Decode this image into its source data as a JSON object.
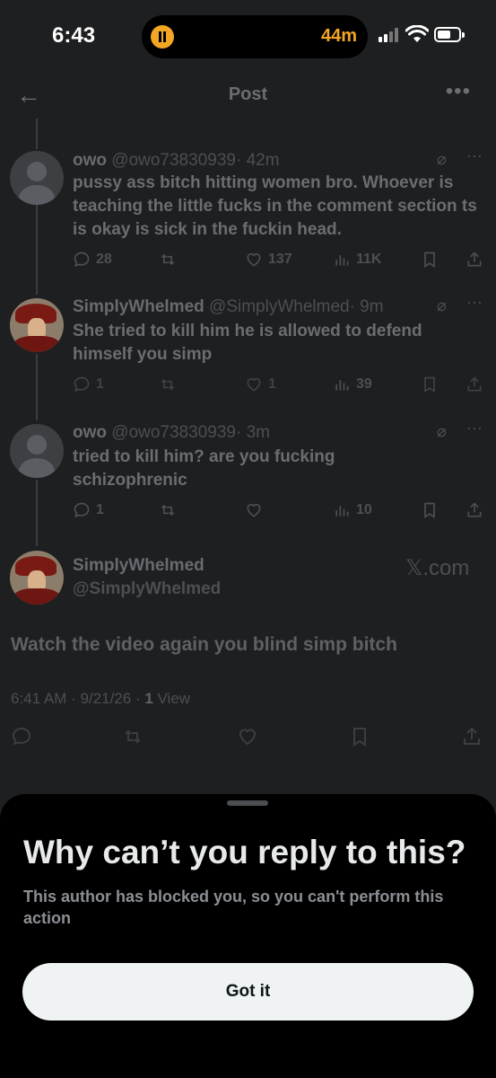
{
  "status_bar": {
    "time": "6:43",
    "activity_minutes": "44m"
  },
  "header": {
    "back_icon": "←",
    "title": "Post",
    "more_icon": "•••"
  },
  "replies": [
    {
      "name": "owo",
      "handle": "@owo73830939",
      "time": "· 42m",
      "text": "pussy ass bitch hitting women bro. Whoever is teaching the little fucks in the comment section ts is okay is sick in the fuckin head.",
      "replies": "28",
      "reposts": "",
      "likes": "137",
      "views": "11K"
    },
    {
      "name": "SimplyWhelmed",
      "handle": "@SimplyWhelmed",
      "time": "· 9m",
      "text": "She tried to kill him he is allowed to defend himself you simp",
      "replies": "1",
      "reposts": "",
      "likes": "1",
      "views": "39"
    },
    {
      "name": "owo",
      "handle": "@owo73830939",
      "time": "· 3m",
      "text": "tried to kill him? are you fucking schizophrenic",
      "replies": "1",
      "reposts": "",
      "likes": "",
      "views": "10"
    }
  ],
  "main_post": {
    "name": "SimplyWhelmed",
    "handle": "@SimplyWhelmed",
    "source": "𝕏.com",
    "text": "Watch the video again you blind simp bitch",
    "timestamp": "6:41 AM · 9/21/26 · ",
    "views_count": "1",
    "views_label": " View"
  },
  "sheet": {
    "title": "Why can’t you reply to this?",
    "description": "This author has blocked you, so you can't perform this action",
    "button_label": "Got it"
  }
}
